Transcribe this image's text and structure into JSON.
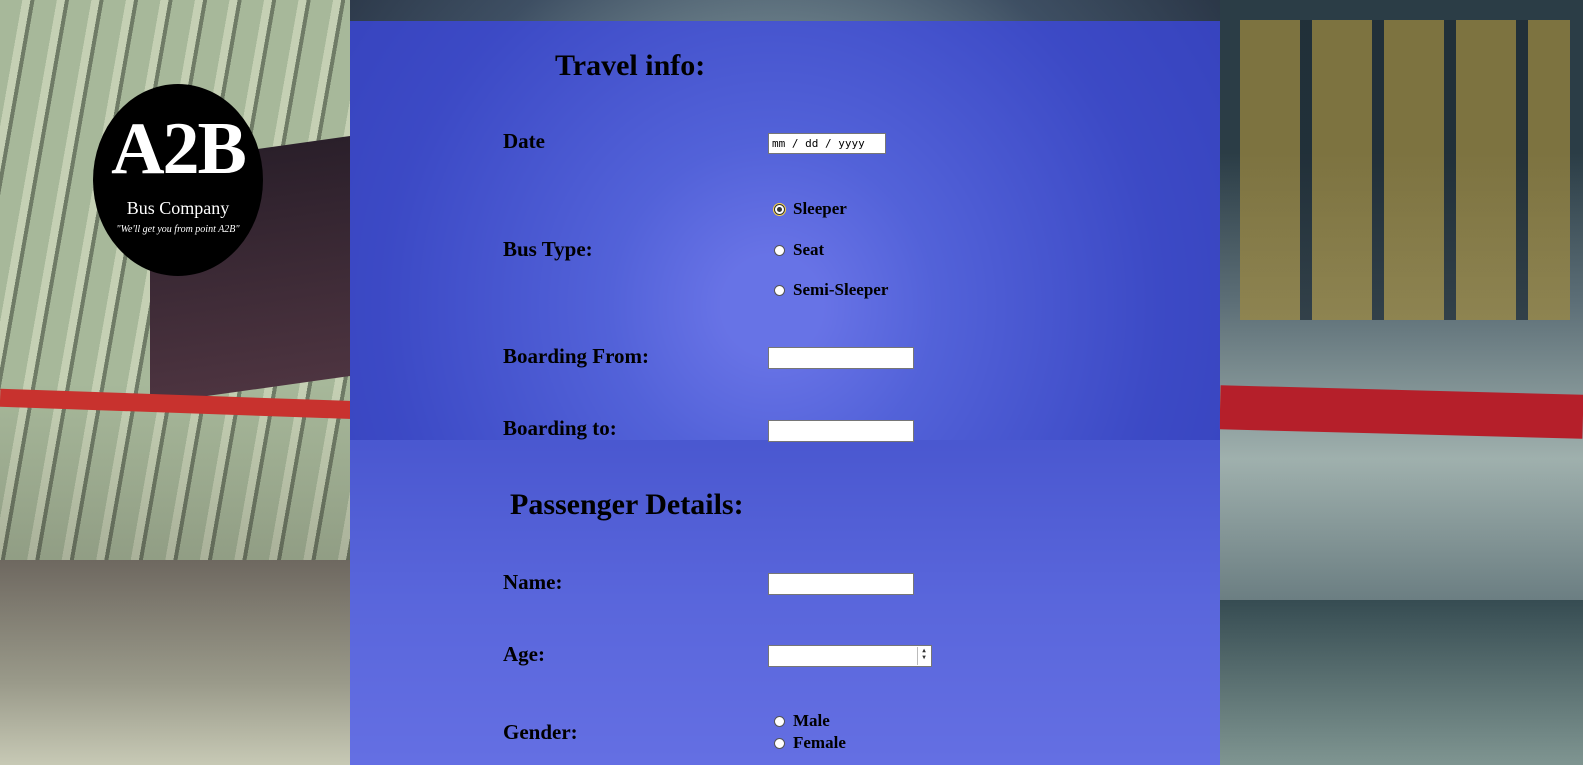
{
  "logo": {
    "mark": "A2B",
    "subtitle": "Bus Company",
    "tagline": "\"We'll get you from point A2B\""
  },
  "travel": {
    "heading": "Travel info:",
    "date_label": "Date",
    "date_placeholder": "mm / dd / yyyy",
    "bus_type_label": "Bus Type:",
    "bus_types": [
      "Sleeper",
      "Seat",
      "Semi-Sleeper"
    ],
    "bus_type_selected": "Sleeper",
    "boarding_from_label": "Boarding From:",
    "boarding_to_label": "Boarding to:"
  },
  "passenger": {
    "heading": "Passenger Details:",
    "name_label": "Name:",
    "age_label": "Age:",
    "gender_label": "Gender:",
    "genders": [
      "Male",
      "Female"
    ]
  },
  "colors": {
    "panel_overlay": "#3c48eb",
    "logo_bg": "#000000"
  }
}
